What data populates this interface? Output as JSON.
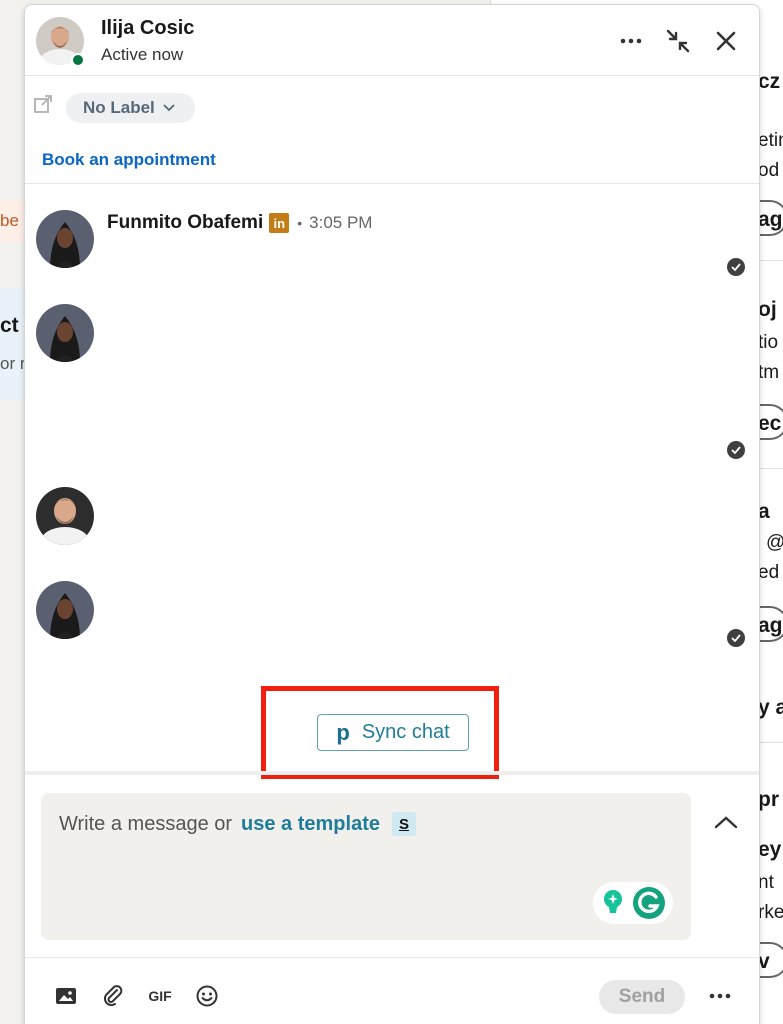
{
  "header": {
    "name": "Ilija Cosic",
    "status": "Active now"
  },
  "label_bar": {
    "label": "No Label",
    "book_link": "Book an appointment"
  },
  "messages": [
    {
      "sender": "Funmito Obafemi",
      "separator": "•",
      "time": "3:05 PM",
      "badge": "in"
    }
  ],
  "sync": {
    "logo": "p",
    "label": "Sync chat"
  },
  "composer": {
    "placeholder": "Write a message or",
    "template_link": "use a template",
    "shortcut_badge": "S"
  },
  "toolbar": {
    "gif_label": "GIF",
    "send_label": "Send"
  },
  "background": {
    "left_fragments": [
      "be",
      "ct c",
      "or r"
    ],
    "right_fragments": [
      "cz",
      "etin",
      "od",
      "ag",
      "oj",
      "tio",
      "tm",
      "ec",
      "a",
      "@",
      "ed",
      "ag",
      "y a",
      "pr",
      "ey",
      "nt",
      "rke",
      "v"
    ]
  },
  "colors": {
    "accent_link": "#0a66c2",
    "sync_teal": "#1f7d9a",
    "highlight_red": "#f11f0f",
    "presence_green": "#057642",
    "linkedin_badge": "#c37d16"
  },
  "icons": [
    "more-icon",
    "minimize-icon",
    "close-icon",
    "external-link-icon",
    "chevron-down-icon",
    "check-circle-icon",
    "image-icon",
    "paperclip-icon",
    "emoji-icon",
    "chevron-up-icon",
    "grammarly-icon",
    "lightbulb-icon"
  ]
}
